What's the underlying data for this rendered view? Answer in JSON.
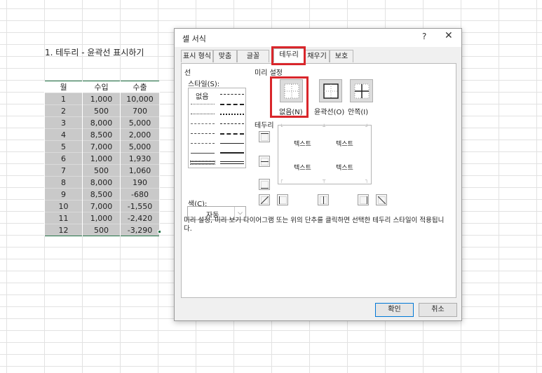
{
  "sheet": {
    "heading": "1. 테두리 - 윤곽선 표시하기",
    "table": {
      "headers": [
        "월",
        "수입",
        "수출"
      ],
      "rows": [
        [
          "1",
          "1,000",
          "10,000"
        ],
        [
          "2",
          "500",
          "700"
        ],
        [
          "3",
          "8,000",
          "5,000"
        ],
        [
          "4",
          "8,500",
          "2,000"
        ],
        [
          "5",
          "7,000",
          "5,000"
        ],
        [
          "6",
          "1,000",
          "1,930"
        ],
        [
          "7",
          "500",
          "1,060"
        ],
        [
          "8",
          "8,000",
          "190"
        ],
        [
          "9",
          "8,500",
          "-680"
        ],
        [
          "10",
          "7,000",
          "-1,550"
        ],
        [
          "11",
          "1,000",
          "-2,420"
        ],
        [
          "12",
          "500",
          "-3,290"
        ]
      ]
    }
  },
  "dialog": {
    "title": "셀 서식",
    "help": "?",
    "close": "✕",
    "tabs": [
      "표시 형식",
      "맞춤",
      "글꼴",
      "테두리",
      "채우기",
      "보호"
    ],
    "active_tab": "테두리",
    "line_section": {
      "title": "선",
      "style_label": "스타일(S):",
      "none_label": "없음",
      "color_label": "색(C):",
      "color_value": "자동"
    },
    "presets": {
      "title": "미리 설정",
      "items": [
        "없음(N)",
        "윤곽선(O)",
        "안쪽(I)"
      ]
    },
    "border_section": {
      "title": "테두리",
      "preview_text": [
        "텍스트",
        "텍스트",
        "텍스트",
        "텍스트"
      ]
    },
    "description": "미리 설정, 미리 보기 다이어그램 또는 위의 단추를 클릭하면 선택한 테두리 스타일이 적용됩니다.",
    "ok_label": "확인",
    "cancel_label": "취소"
  },
  "colors": {
    "highlight_red": "#d9262b",
    "selection_green": "#217346",
    "cell_gray": "#c9c9c9"
  }
}
